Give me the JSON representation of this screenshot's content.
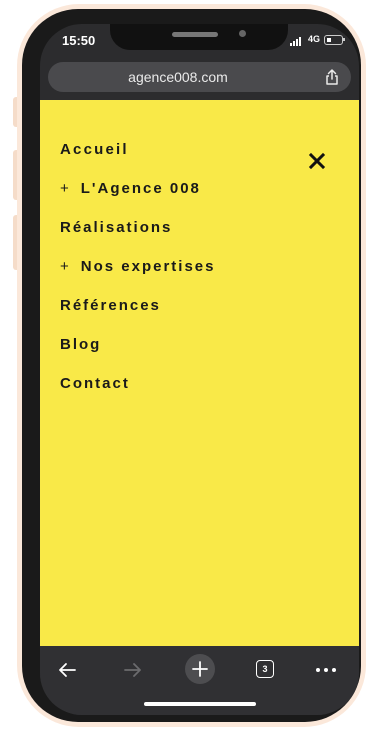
{
  "status_bar": {
    "time": "15:50",
    "network": "4G"
  },
  "browser": {
    "url": "agence008.com",
    "tab_count": "3"
  },
  "menu": {
    "items": [
      {
        "label": "Accueil",
        "expandable": false
      },
      {
        "label": "L'Agence 008",
        "expandable": true,
        "prefix": "+"
      },
      {
        "label": "Réalisations",
        "expandable": false
      },
      {
        "label": "Nos expertises",
        "expandable": true,
        "prefix": "+"
      },
      {
        "label": "Références",
        "expandable": false
      },
      {
        "label": "Blog",
        "expandable": false
      },
      {
        "label": "Contact",
        "expandable": false
      }
    ]
  },
  "colors": {
    "menu_background": "#f9e948",
    "browser_chrome": "#2c2c2e",
    "phone_frame": "#fbe8da"
  },
  "icons": {
    "close": "close-icon",
    "share": "share-icon",
    "back": "back-arrow-icon",
    "forward": "forward-arrow-icon",
    "new_tab": "plus-icon",
    "tabs": "tabs-icon",
    "more": "more-icon"
  }
}
